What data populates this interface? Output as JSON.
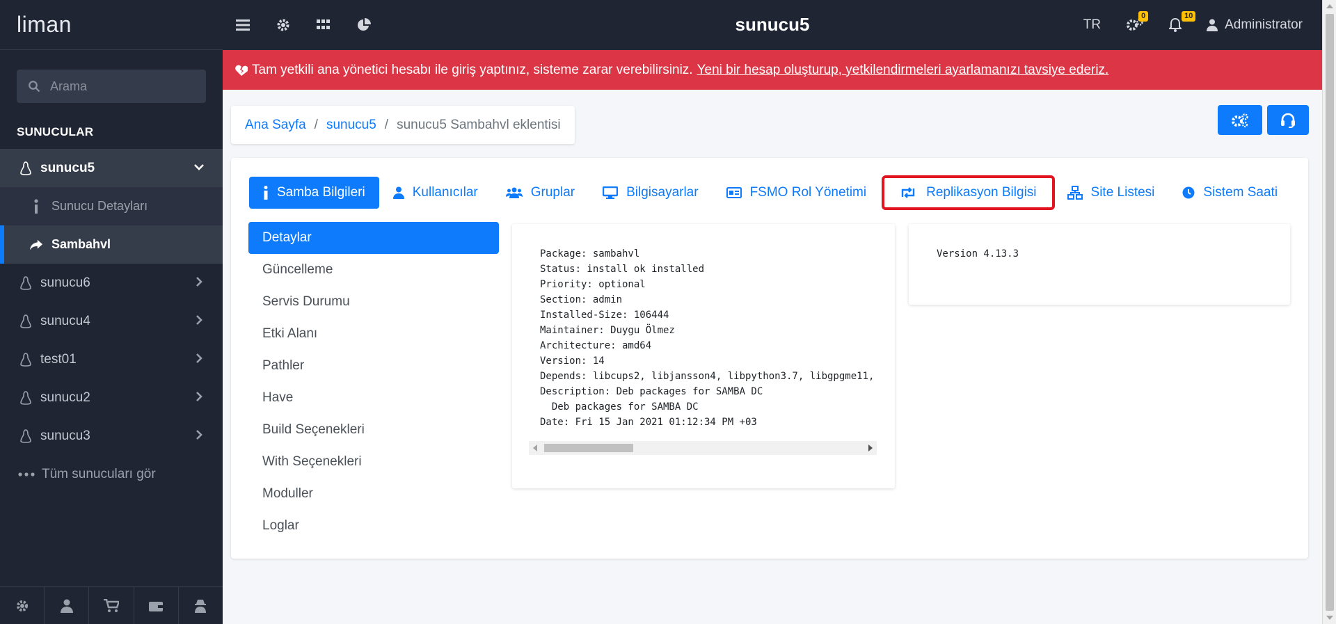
{
  "brand": "liman",
  "search": {
    "placeholder": "Arama"
  },
  "sidebar": {
    "section_title": "SUNUCULAR",
    "servers": [
      {
        "label": "sunucu5",
        "expanded": true
      },
      {
        "label": "sunucu6"
      },
      {
        "label": "sunucu4"
      },
      {
        "label": "test01"
      },
      {
        "label": "sunucu2"
      },
      {
        "label": "sunucu3"
      }
    ],
    "sub_items": [
      {
        "label": "Sunucu Detayları"
      },
      {
        "label": "Sambahvl",
        "active": true
      }
    ],
    "see_all": "Tüm sunucuları gör"
  },
  "topbar": {
    "title": "sunucu5",
    "language": "TR",
    "settings_badge": "0",
    "notifications_badge": "10",
    "user": "Administrator"
  },
  "alert": {
    "text": "Tam yetkili ana yönetici hesabı ile giriş yaptınız, sisteme zarar verebilirsiniz.",
    "link": "Yeni bir hesap oluşturup, yetkilendirmeleri ayarlamanızı tavsiye ederiz."
  },
  "breadcrumb": {
    "home": "Ana Sayfa",
    "server": "sunucu5",
    "current": "sunucu5 Sambahvl eklentisi"
  },
  "tabs": [
    {
      "label": "Samba Bilgileri",
      "active": true
    },
    {
      "label": "Kullanıcılar"
    },
    {
      "label": "Gruplar"
    },
    {
      "label": "Bilgisayarlar"
    },
    {
      "label": "FSMO Rol Yönetimi"
    },
    {
      "label": "Replikasyon Bilgisi",
      "highlighted": true
    },
    {
      "label": "Site Listesi"
    },
    {
      "label": "Sistem Saati"
    }
  ],
  "subnav": [
    {
      "label": "Detaylar",
      "active": true
    },
    {
      "label": "Güncelleme"
    },
    {
      "label": "Servis Durumu"
    },
    {
      "label": "Etki Alanı"
    },
    {
      "label": "Pathler"
    },
    {
      "label": "Have"
    },
    {
      "label": "Build Seçenekleri"
    },
    {
      "label": "With Seçenekleri"
    },
    {
      "label": "Moduller"
    },
    {
      "label": "Loglar"
    }
  ],
  "package_info": "Package: sambahvl\nStatus: install ok installed\nPriority: optional\nSection: admin\nInstalled-Size: 106444\nMaintainer: Duygu Ölmez\nArchitecture: amd64\nVersion: 14\nDepends: libcups2, libjansson4, libpython3.7, libgpgme11,\nDescription: Deb packages for SAMBA DC\n  Deb packages for SAMBA DC\nDate: Fri 15 Jan 2021 01:12:34 PM +03",
  "version_info": "Version 4.13.3",
  "colors": {
    "sidebar_bg": "#1f2533",
    "accent": "#0d7bfb",
    "alert": "#dc3545",
    "highlight_box": "#e0151f",
    "badge": "#ffc107"
  }
}
